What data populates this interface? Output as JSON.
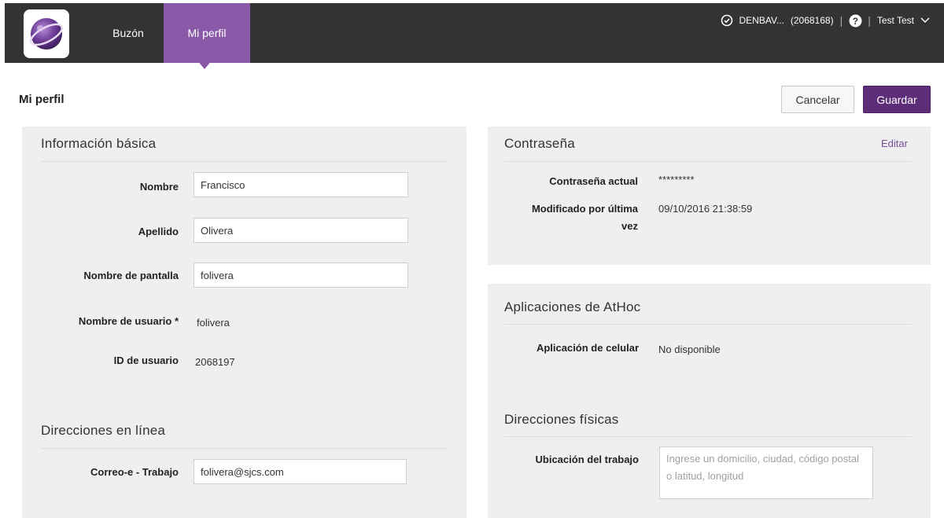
{
  "nav": {
    "tabs": [
      {
        "label": "Buzón"
      },
      {
        "label": "Mi perfil"
      }
    ]
  },
  "header": {
    "org": "DENBAV...",
    "org_id": "(2068168)",
    "user": "Test Test"
  },
  "page": {
    "title": "Mi perfil",
    "cancel_label": "Cancelar",
    "save_label": "Guardar"
  },
  "basic": {
    "title": "Información básica",
    "first_name_label": "Nombre",
    "first_name_value": "Francisco",
    "last_name_label": "Apellido",
    "last_name_value": "Olivera",
    "display_name_label": "Nombre de pantalla",
    "display_name_value": "folivera",
    "username_label": "Nombre de usuario *",
    "username_value": "folivera",
    "user_id_label": "ID de usuario",
    "user_id_value": "2068197"
  },
  "online": {
    "title": "Direcciones en línea",
    "work_email_label": "Correo-e - Trabajo",
    "work_email_value": "folivera@sjcs.com"
  },
  "password": {
    "title": "Contraseña",
    "edit_label": "Editar",
    "current_label": "Contraseña actual",
    "current_value": "*********",
    "modified_label_line1": "Modificado por última",
    "modified_label_line2": "vez",
    "modified_value": "09/10/2016 21:38:59"
  },
  "apps": {
    "title": "Aplicaciones de AtHoc",
    "mobile_label": "Aplicación de celular",
    "mobile_value": "No disponible"
  },
  "physical": {
    "title": "Direcciones físicas",
    "work_location_label": "Ubicación del trabajo",
    "work_location_placeholder": "Ingrese un domicilio, ciudad, código postal o latitud, longitud"
  },
  "colors": {
    "topbar": "#333333",
    "accent": "#8a5aa8",
    "save_button": "#5e2d79",
    "panel": "#efefef",
    "link": "#7a4c9a"
  },
  "icons": [
    "app-logo-icon",
    "clock-icon",
    "help-icon",
    "chevron-down-icon"
  ]
}
